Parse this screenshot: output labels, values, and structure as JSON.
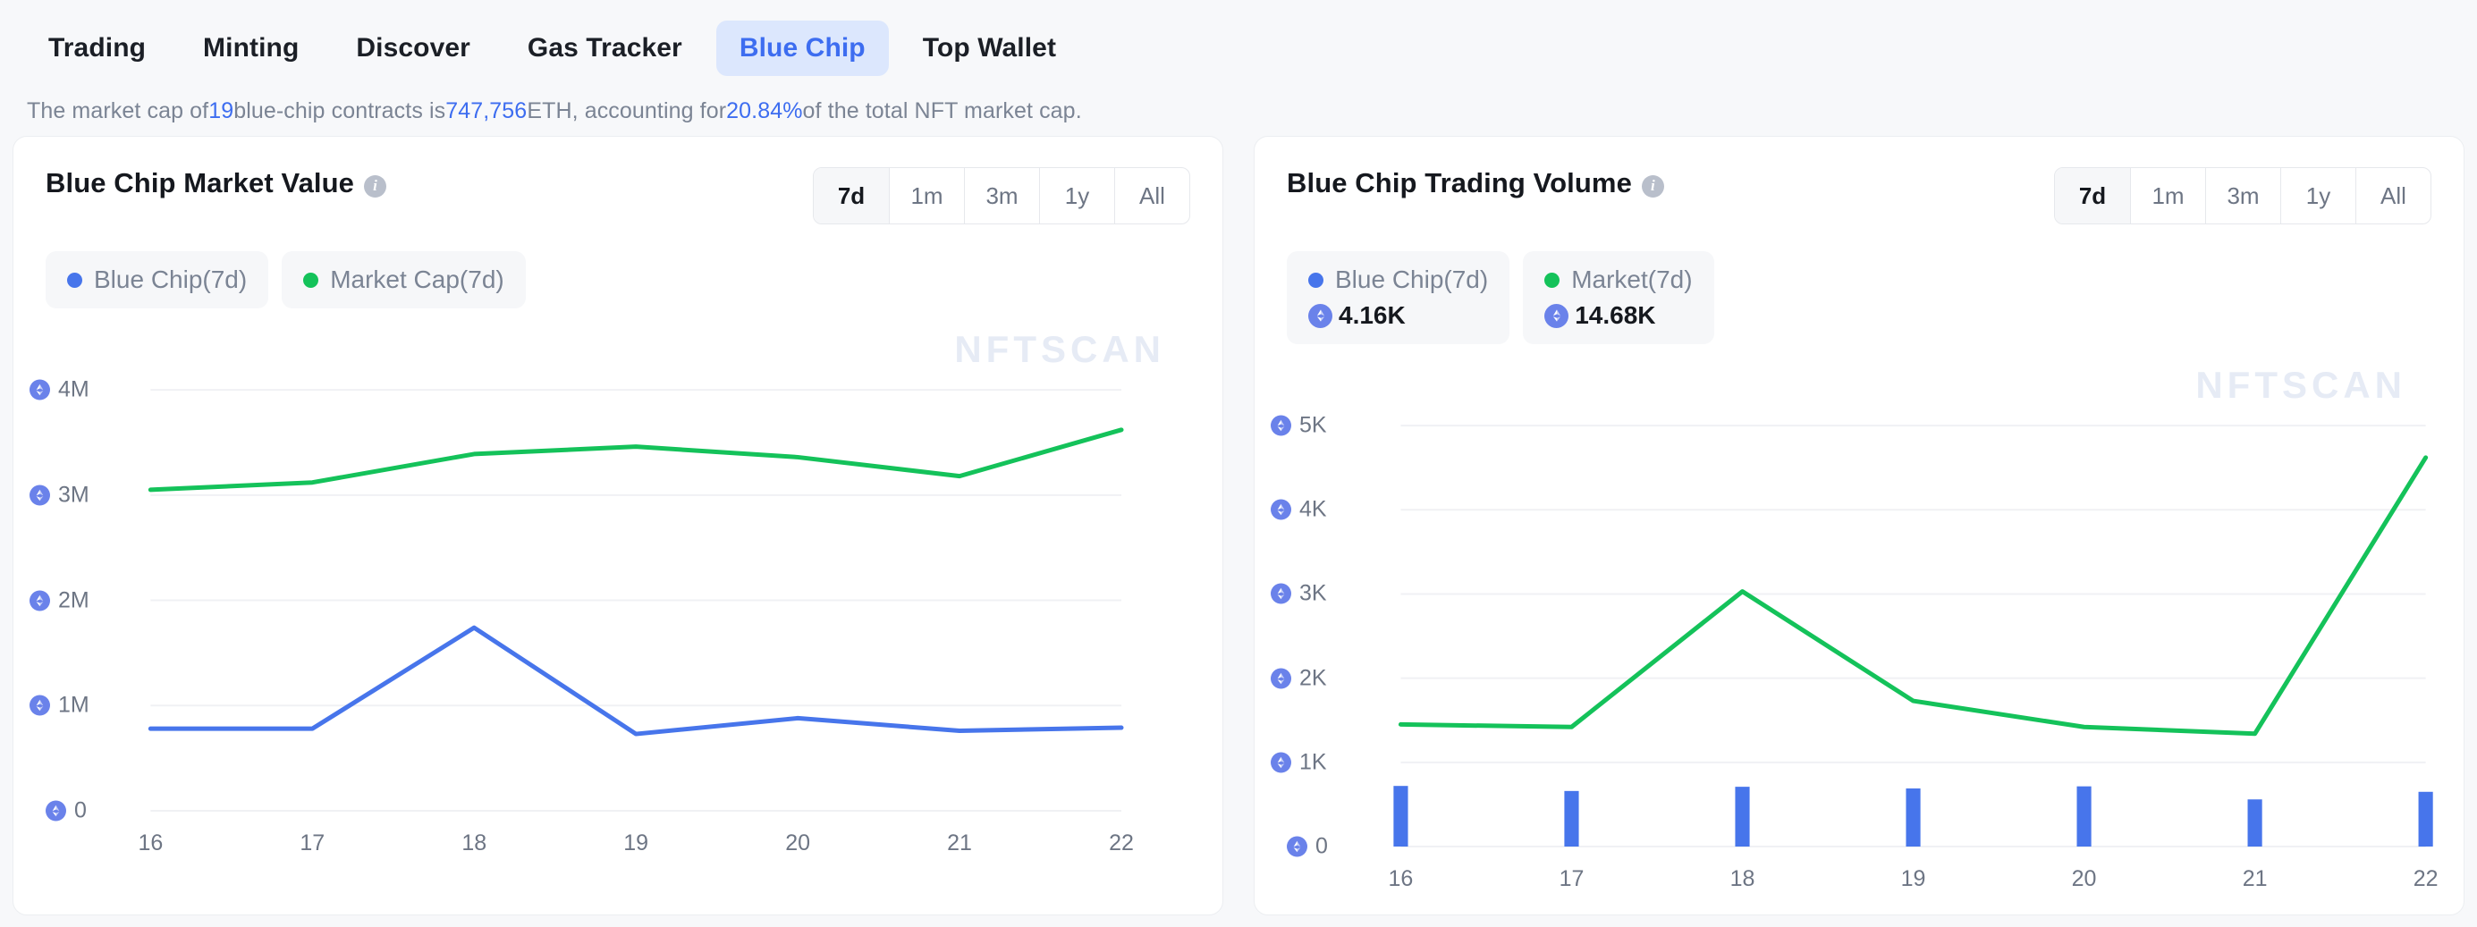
{
  "nav": {
    "items": [
      {
        "label": "Trading",
        "active": false
      },
      {
        "label": "Minting",
        "active": false
      },
      {
        "label": "Discover",
        "active": false
      },
      {
        "label": "Gas Tracker",
        "active": false
      },
      {
        "label": "Blue Chip",
        "active": true
      },
      {
        "label": "Top Wallet",
        "active": false
      }
    ]
  },
  "summary": {
    "t1": "The market cap of ",
    "v1": "19",
    "t2": " blue-chip contracts is ",
    "v2": "747,756",
    "t3": " ETH, accounting for ",
    "v3": "20.84%",
    "t4": " of the total NFT market cap."
  },
  "watermark": "NFTSCAN",
  "colors": {
    "blue": "#4775eb",
    "green": "#14c25a",
    "accent": "#3d6df0",
    "grid": "#f0f1f4",
    "eth_badge": "#6a82ea"
  },
  "range": {
    "options": [
      "7d",
      "1m",
      "3m",
      "1y",
      "All"
    ],
    "selected": "7d"
  },
  "cards": [
    {
      "title": "Blue Chip Market Value",
      "info_icon": "info-icon",
      "legends": [
        {
          "label": "Blue Chip(7d)",
          "color": "#4775eb",
          "value": null
        },
        {
          "label": "Market Cap(7d)",
          "color": "#14c25a",
          "value": null
        }
      ]
    },
    {
      "title": "Blue Chip Trading Volume",
      "info_icon": "info-icon",
      "legends": [
        {
          "label": "Blue Chip(7d)",
          "color": "#4775eb",
          "value": "4.16K"
        },
        {
          "label": "Market(7d)",
          "color": "#14c25a",
          "value": "14.68K"
        }
      ]
    }
  ],
  "chart_data": [
    {
      "type": "line",
      "title": "Blue Chip Market Value",
      "xlabel": "",
      "ylabel": "ETH",
      "x": [
        "16",
        "17",
        "18",
        "19",
        "20",
        "21",
        "22"
      ],
      "ytick_labels": [
        "0",
        "1M",
        "2M",
        "3M",
        "4M"
      ],
      "ytick_values": [
        0,
        1000000,
        2000000,
        3000000,
        4000000
      ],
      "ylim": [
        0,
        4400000
      ],
      "grid": true,
      "legend_position": "top-left",
      "series": [
        {
          "name": "Blue Chip(7d)",
          "color": "#4775eb",
          "values": [
            780000,
            780000,
            1740000,
            730000,
            880000,
            760000,
            790000
          ]
        },
        {
          "name": "Market Cap(7d)",
          "color": "#14c25a",
          "values": [
            3050000,
            3120000,
            3390000,
            3460000,
            3360000,
            3180000,
            3620000
          ]
        }
      ]
    },
    {
      "type": "bar+line",
      "title": "Blue Chip Trading Volume",
      "xlabel": "",
      "ylabel": "ETH",
      "x": [
        "16",
        "17",
        "18",
        "19",
        "20",
        "21",
        "22"
      ],
      "ytick_labels": [
        "0",
        "1K",
        "2K",
        "3K",
        "4K",
        "5K"
      ],
      "ytick_values": [
        0,
        1000,
        2000,
        3000,
        4000,
        5000
      ],
      "ylim": [
        0,
        5500
      ],
      "grid": true,
      "legend_position": "top-left",
      "series": [
        {
          "name": "Blue Chip(7d)",
          "type": "bar",
          "color": "#4775eb",
          "values": [
            720,
            660,
            710,
            690,
            715,
            560,
            650
          ]
        },
        {
          "name": "Market(7d)",
          "type": "line",
          "color": "#14c25a",
          "values": [
            1450,
            1420,
            3030,
            1730,
            1420,
            1340,
            4620
          ]
        }
      ]
    }
  ]
}
